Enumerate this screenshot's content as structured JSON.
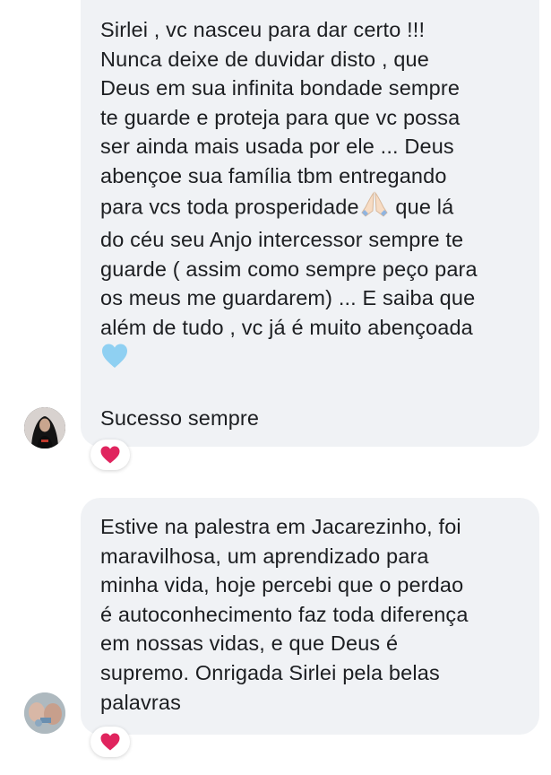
{
  "comments": [
    {
      "author_avatar": "profile-photo",
      "paragraph_1": "Sirlei , vc nasceu para dar certo !!!\nNunca deixe de duvidar disto , que\nDeus em sua infinita bondade sempre\nte guarde e proteja para que vc possa\nser ainda mais usada por ele ... Deus\nabençoe sua família tbm entregando\npara vcs toda prosperidade",
      "emoji_1": "folded-hands-emoji",
      "paragraph_1b": " que lá\ndo céu seu Anjo intercessor sempre te\nguarde ( assim como sempre peço para\nos meus me guardarem) ... E saiba que\nalém de tudo , vc já é muito abençoada",
      "emoji_2": "light-blue-heart-emoji",
      "paragraph_2": "Sucesso sempre",
      "reaction": "red-heart-icon"
    },
    {
      "author_avatar": "profile-photo",
      "text": "Estive na palestra em Jacarezinho, foi\nmaravilhosa, um aprendizado para\nminha vida, hoje percebi que o perdao\né autoconhecimento faz toda diferença\nem nossas vidas, e que Deus é\nsupremo. Onrigada Sirlei pela belas\npalavras",
      "reaction": "red-heart-icon"
    }
  ],
  "colors": {
    "bubble": "#f0f2f5",
    "text": "#1c1e21",
    "reaction_heart": "#e0245e"
  }
}
